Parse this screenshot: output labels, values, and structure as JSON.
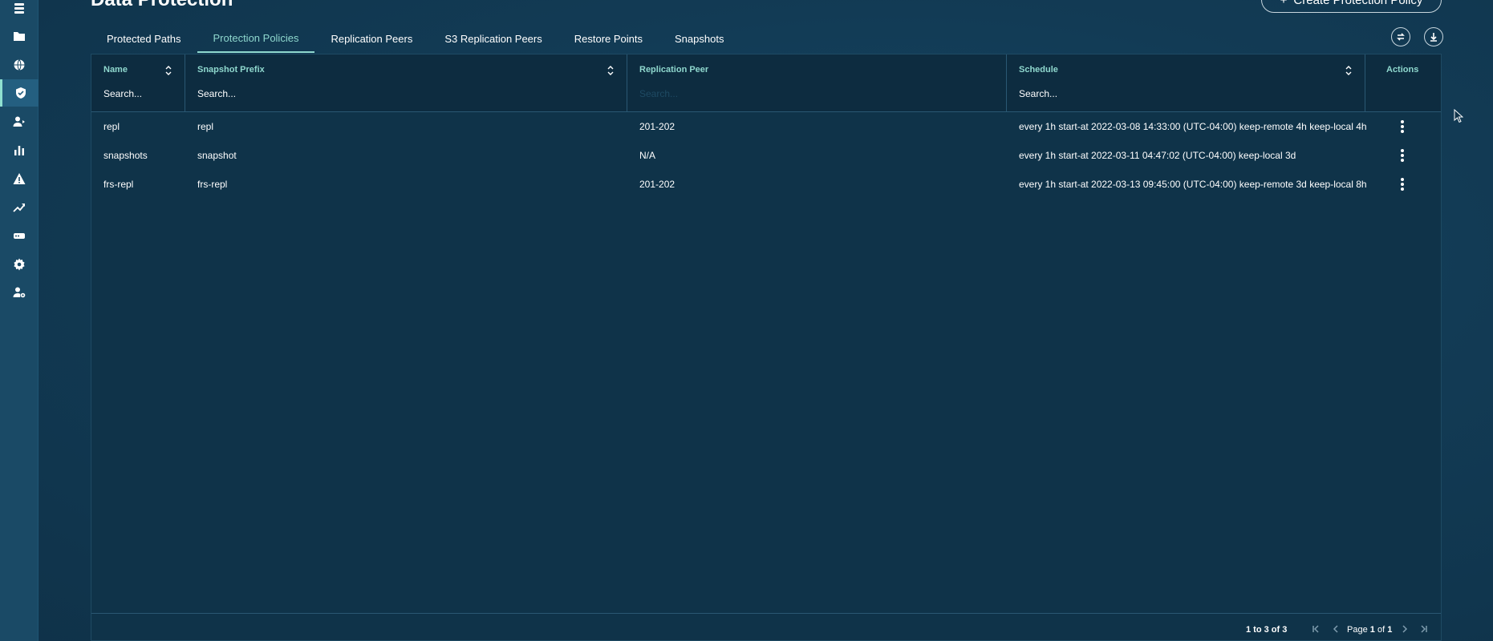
{
  "app": {
    "page_title": "Data Protection",
    "create_button_label": "Create Protection Policy"
  },
  "sidebar": {
    "items": [
      {
        "icon": "list-icon"
      },
      {
        "icon": "folder-icon"
      },
      {
        "icon": "globe-icon"
      },
      {
        "icon": "shield-icon",
        "active": true
      },
      {
        "icon": "user-share-icon"
      },
      {
        "icon": "bar-chart-icon"
      },
      {
        "icon": "warning-icon"
      },
      {
        "icon": "trend-icon"
      },
      {
        "icon": "drive-icon"
      },
      {
        "icon": "gear-icon"
      },
      {
        "icon": "user-gear-icon"
      }
    ]
  },
  "tabs": [
    {
      "label": "Protected Paths"
    },
    {
      "label": "Protection Policies",
      "active": true
    },
    {
      "label": "Replication Peers"
    },
    {
      "label": "S3 Replication Peers"
    },
    {
      "label": "Restore Points"
    },
    {
      "label": "Snapshots"
    }
  ],
  "toolbar": {
    "refresh_icon": "refresh-icon",
    "download_icon": "download-icon"
  },
  "grid": {
    "columns": [
      {
        "title": "Name",
        "search_placeholder": "Search..."
      },
      {
        "title": "Snapshot Prefix",
        "search_placeholder": "Search..."
      },
      {
        "title": "Replication Peer",
        "search_placeholder": "Search..."
      },
      {
        "title": "Schedule",
        "search_placeholder": "Search..."
      },
      {
        "title": "Actions"
      }
    ],
    "rows": [
      {
        "name": "repl",
        "prefix": "repl",
        "peer": "201-202",
        "schedule": "every 1h start-at 2022-03-08 14:33:00 (UTC-04:00) keep-remote 4h keep-local 4h"
      },
      {
        "name": "snapshots",
        "prefix": "snapshot",
        "peer": "N/A",
        "schedule": "every 1h start-at 2022-03-11 04:47:02 (UTC-04:00) keep-local 3d"
      },
      {
        "name": "frs-repl",
        "prefix": "frs-repl",
        "peer": "201-202",
        "schedule": "every 1h start-at 2022-03-13 09:45:00 (UTC-04:00) keep-remote 3d keep-local 8h"
      }
    ]
  },
  "pagination": {
    "summary": "1 to 3 of 3",
    "page_label": "Page",
    "current_page": "1",
    "of_label": "of",
    "total_pages": "1"
  },
  "colors": {
    "accent": "#8fd8ce",
    "background": "#133a52",
    "sidebar": "#1a4a66"
  }
}
